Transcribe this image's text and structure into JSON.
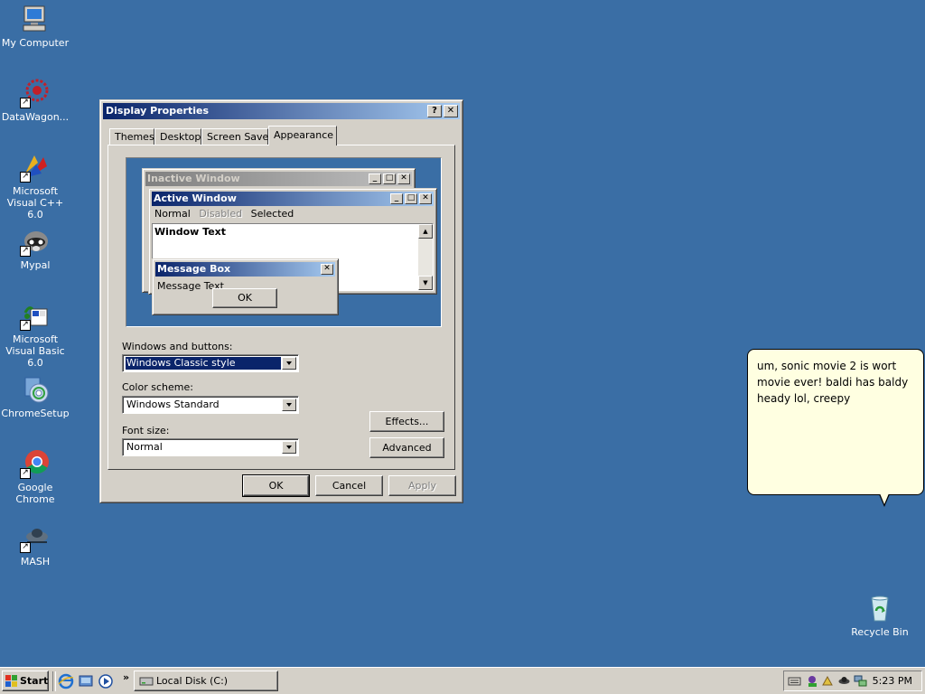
{
  "desktop": {
    "background": "#3A6EA5",
    "icons": [
      {
        "label": "My Computer"
      },
      {
        "label": "DataWagon..."
      },
      {
        "label": "Microsoft Visual C++ 6.0"
      },
      {
        "label": "Mypal"
      },
      {
        "label": "Microsoft Visual Basic 6.0"
      },
      {
        "label": "ChromeSetup"
      },
      {
        "label": "Google Chrome"
      },
      {
        "label": "MASH"
      },
      {
        "label": "Recycle Bin"
      }
    ]
  },
  "dialog": {
    "title": "Display Properties",
    "help_btn": "?",
    "close_btn": "✕",
    "tabs": [
      "Themes",
      "Desktop",
      "Screen Saver",
      "Appearance"
    ],
    "preview": {
      "inactive_title": "Inactive Window",
      "active_title": "Active Window",
      "menu": [
        "Normal",
        "Disabled",
        "Selected"
      ],
      "window_text": "Window Text",
      "msgbox_title": "Message Box",
      "msgbox_text": "Message Text",
      "msgbox_ok": "OK"
    },
    "windows_buttons_label": "Windows and buttons:",
    "windows_buttons_value": "Windows Classic style",
    "color_scheme_label": "Color scheme:",
    "color_scheme_value": "Windows Standard",
    "font_size_label": "Font size:",
    "font_size_value": "Normal",
    "effects_btn": "Effects...",
    "advanced_btn": "Advanced",
    "ok_btn": "OK",
    "cancel_btn": "Cancel",
    "apply_btn": "Apply"
  },
  "bubble": {
    "text": "um, sonic movie 2 is wort movie ever! baldi has baldy heady lol, creepy"
  },
  "taskbar": {
    "start_label": "Start",
    "chevron": "»",
    "task_label": "Local Disk (C:)",
    "clock": "5:23 PM"
  }
}
